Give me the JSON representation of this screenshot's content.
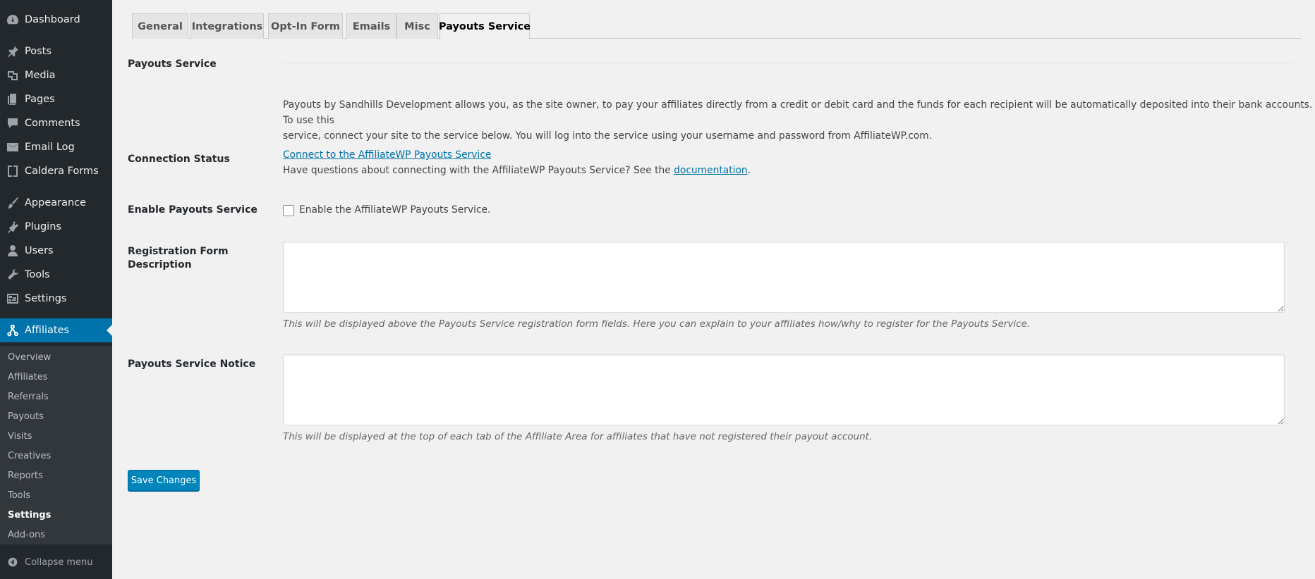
{
  "sidebar": {
    "items": [
      {
        "label": "Dashboard",
        "icon": "dashboard-icon"
      },
      {
        "label": "Posts",
        "icon": "pin-icon"
      },
      {
        "label": "Media",
        "icon": "media-icon"
      },
      {
        "label": "Pages",
        "icon": "pages-icon"
      },
      {
        "label": "Comments",
        "icon": "comment-icon"
      },
      {
        "label": "Email Log",
        "icon": "email-icon"
      },
      {
        "label": "Caldera Forms",
        "icon": "caldera-icon"
      },
      {
        "label": "Appearance",
        "icon": "brush-icon"
      },
      {
        "label": "Plugins",
        "icon": "plugin-icon"
      },
      {
        "label": "Users",
        "icon": "user-icon"
      },
      {
        "label": "Tools",
        "icon": "wrench-icon"
      },
      {
        "label": "Settings",
        "icon": "settings-icon"
      },
      {
        "label": "Affiliates",
        "icon": "affiliates-icon"
      }
    ],
    "submenu": [
      "Overview",
      "Affiliates",
      "Referrals",
      "Payouts",
      "Visits",
      "Creatives",
      "Reports",
      "Tools",
      "Settings",
      "Add-ons"
    ],
    "collapse_label": "Collapse menu"
  },
  "tabs": [
    "General",
    "Integrations",
    "Opt-In Form",
    "Emails",
    "Misc",
    "Payouts Service"
  ],
  "active_tab": "Payouts Service",
  "form": {
    "section_title": "Payouts Service",
    "intro_line1": "Payouts by Sandhills Development allows you, as the site owner, to pay your affiliates directly from a credit or debit card and the funds for each recipient will be automatically deposited into their bank accounts. To use this",
    "intro_line2": "service, connect your site to the service below. You will log into the service using your username and password from AffiliateWP.com.",
    "connection_label": "Connection Status",
    "connect_link": "Connect to the AffiliateWP Payouts Service",
    "question_prefix": "Have questions about connecting with the AffiliateWP Payouts Service? See the ",
    "documentation_link": "documentation",
    "question_suffix": ".",
    "enable_label": "Enable Payouts Service",
    "enable_checkbox_label": "Enable the AffiliateWP Payouts Service.",
    "enable_checked": false,
    "registration_label_line1": "Registration Form",
    "registration_label_line2": "Description",
    "registration_value": "",
    "registration_desc": "This will be displayed above the Payouts Service registration form fields. Here you can explain to your affiliates how/why to register for the Payouts Service.",
    "notice_label": "Payouts Service Notice",
    "notice_value": "",
    "notice_desc": "This will be displayed at the top of each tab of the Affiliate Area for affiliates that have not registered their payout account.",
    "save_label": "Save Changes"
  },
  "colors": {
    "sidebar_bg": "#23282d",
    "submenu_bg": "#32373c",
    "accent": "#0073aa",
    "button": "#0085ba"
  }
}
